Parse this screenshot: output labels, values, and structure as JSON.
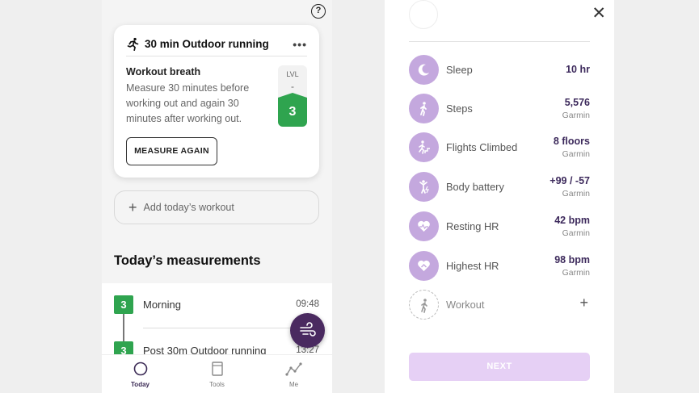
{
  "left_screen": {
    "workout_card": {
      "title": "30 min Outdoor running",
      "more_label": "•••",
      "subtitle": "Workout breath",
      "description": "Measure 30 minutes before working out and again 30 minutes after working out.",
      "level_label": "LVL",
      "level_empty": "-",
      "level_value": "3",
      "measure_button": "MEASURE AGAIN"
    },
    "add_workout": {
      "plus": "+",
      "label": "Add today’s workout"
    },
    "section_title": "Today’s measurements",
    "measurements": [
      {
        "level": "3",
        "name": "Morning",
        "time": "09:48"
      },
      {
        "level": "3",
        "name": "Post 30m Outdoor running",
        "time": "13:27"
      }
    ],
    "help_label": "?",
    "tabs": [
      {
        "label": "Today",
        "icon": "circle-icon",
        "active": true
      },
      {
        "label": "Tools",
        "icon": "book-icon",
        "active": false
      },
      {
        "label": "Me",
        "icon": "trend-icon",
        "active": false
      }
    ]
  },
  "right_screen": {
    "close_label": "✕",
    "metrics": [
      {
        "name": "Sleep",
        "value": "10 hr",
        "source": "",
        "icon": "moon-icon"
      },
      {
        "name": "Steps",
        "value": "5,576",
        "source": "Garmin",
        "icon": "walk-icon"
      },
      {
        "name": "Flights Climbed",
        "value": "8 floors",
        "source": "Garmin",
        "icon": "stairs-icon"
      },
      {
        "name": "Body battery",
        "value": "+99 / -57",
        "source": "Garmin",
        "icon": "battery-person-icon"
      },
      {
        "name": "Resting HR",
        "value": "42 bpm",
        "source": "Garmin",
        "icon": "heart-icon"
      },
      {
        "name": "Highest HR",
        "value": "98 bpm",
        "source": "Garmin",
        "icon": "heart-up-icon"
      }
    ],
    "workout_row": {
      "name": "Workout",
      "plus": "+"
    },
    "next_button": "NEXT"
  },
  "colors": {
    "accent_green": "#2fa44f",
    "purple_dark": "#3d2a5c",
    "purple_icon": "#c4a8de",
    "next_disabled": "#e6d0f5"
  }
}
